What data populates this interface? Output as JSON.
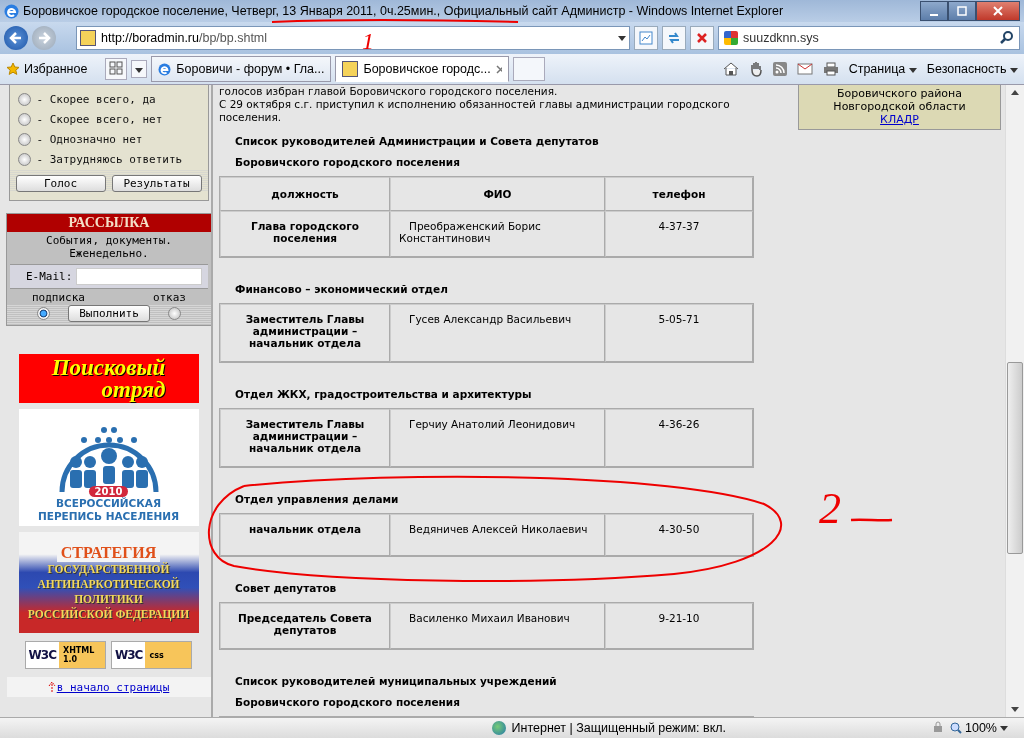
{
  "window": {
    "title": "Боровичское городское поселение, Четверг, 13 Января 2011, 0ч.25мин., Официальный сайт Администр - Windows Internet Explorer",
    "underlined": true,
    "mark_label": "1"
  },
  "address_bar": {
    "url_host": "http://boradmin.ru",
    "url_path": "/bp/bp.shtml"
  },
  "search_field": {
    "value": "suuzdknn.sys"
  },
  "favorites": "Избранное",
  "tabs": [
    {
      "label": "Боровичи - форум • Гла...",
      "selected": false,
      "kind": "ie"
    },
    {
      "label": "Боровичское городс...",
      "selected": true,
      "kind": "site"
    }
  ],
  "command_menus": [
    "Страница",
    "Безопасность"
  ],
  "poll": {
    "options": [
      {
        "label": "- Скорее всего, да",
        "selected": false
      },
      {
        "label": "- Скорее всего, нет",
        "selected": false
      },
      {
        "label": "- Однозначно нет",
        "selected": false
      },
      {
        "label": "- Затрудняюсь ответить",
        "selected": false
      }
    ],
    "buttons": [
      "Голос",
      "Результаты"
    ]
  },
  "mailing": {
    "title": "РАССЫЛКА",
    "description": "События, документы. Еженедельно.",
    "email_label": "E-Mail:",
    "options": [
      {
        "label": "подписка",
        "selected": true
      },
      {
        "label": "отказ",
        "selected": false
      }
    ],
    "submit": "Выполнить"
  },
  "banners": [
    {
      "kind": "search",
      "lines": [
        "Поисковый",
        "отряд"
      ]
    },
    {
      "kind": "census",
      "lines": [
        "2010",
        "ВСЕРОССИЙСКАЯ",
        "ПЕРЕПИСЬ НАСЕЛЕНИЯ"
      ]
    },
    {
      "kind": "strategy",
      "lines": [
        "СТРАТЕГИЯ",
        "ГОСУДАРСТВЕННОЙ",
        "АНТИНАРКОТИЧЕСКОЙ",
        "ПОЛИТИКИ",
        "РОССИЙСКОЙ ФЕДЕРАЦИИ"
      ]
    }
  ],
  "badges": [
    {
      "logo": "W3C",
      "label": "XHTML 1.0"
    },
    {
      "logo": "W3C",
      "label": "css"
    }
  ],
  "top_link": "в начало страницы",
  "intro": [
    "голосов избран главой Боровичского городского поселения.",
    "С 29 октября с.г. приступил к исполнению обязанностей главы администрации городского поселения."
  ],
  "sections": [
    {
      "title": "Список руководителей Администрации и Совета депутатов",
      "subtitle": "Боровичского городского поселения",
      "columns": [
        "должность",
        "ФИО",
        "телефон"
      ],
      "rows": [
        {
          "position": "Глава городского поселения",
          "name": "Преображенский Борис Константинович",
          "phone": "4-37-37"
        }
      ],
      "circled": false
    },
    {
      "title": "Финансово – экономический отдел",
      "rows": [
        {
          "position": "Заместитель Главы администрации – начальник отдела",
          "name": "Гусев Александр Васильевич",
          "phone": "5-05-71"
        }
      ],
      "circled": false
    },
    {
      "title": "Отдел ЖКХ, градостроительства и архитектуры",
      "rows": [
        {
          "position": "Заместитель Главы администрации – начальник отдела",
          "name": "Герчиу Анатолий Леонидович",
          "phone": "4-36-26"
        }
      ],
      "circled": false
    },
    {
      "title": "Отдел управления делами",
      "rows": [
        {
          "position": "начальник отдела",
          "name": "Ведяничев Алексей Николаевич",
          "phone": "4-30-50"
        }
      ],
      "circled": true,
      "mark_label": "2"
    },
    {
      "title": "Совет депутатов",
      "rows": [
        {
          "position": "Председатель Совета депутатов",
          "name": "Василенко Михаил Иванович",
          "phone": "9-21-10"
        }
      ],
      "circled": false
    },
    {
      "title": "Список руководителей муниципальных учреждений",
      "subtitle": "Боровичского городского поселения",
      "circled": false
    }
  ],
  "right_box": {
    "lines": [
      "Боровичского района",
      "Новгородской области"
    ],
    "link": "КЛАДР"
  },
  "status_bar": {
    "zone": "Интернет | Защищенный режим: вкл.",
    "zoom": "100%"
  }
}
